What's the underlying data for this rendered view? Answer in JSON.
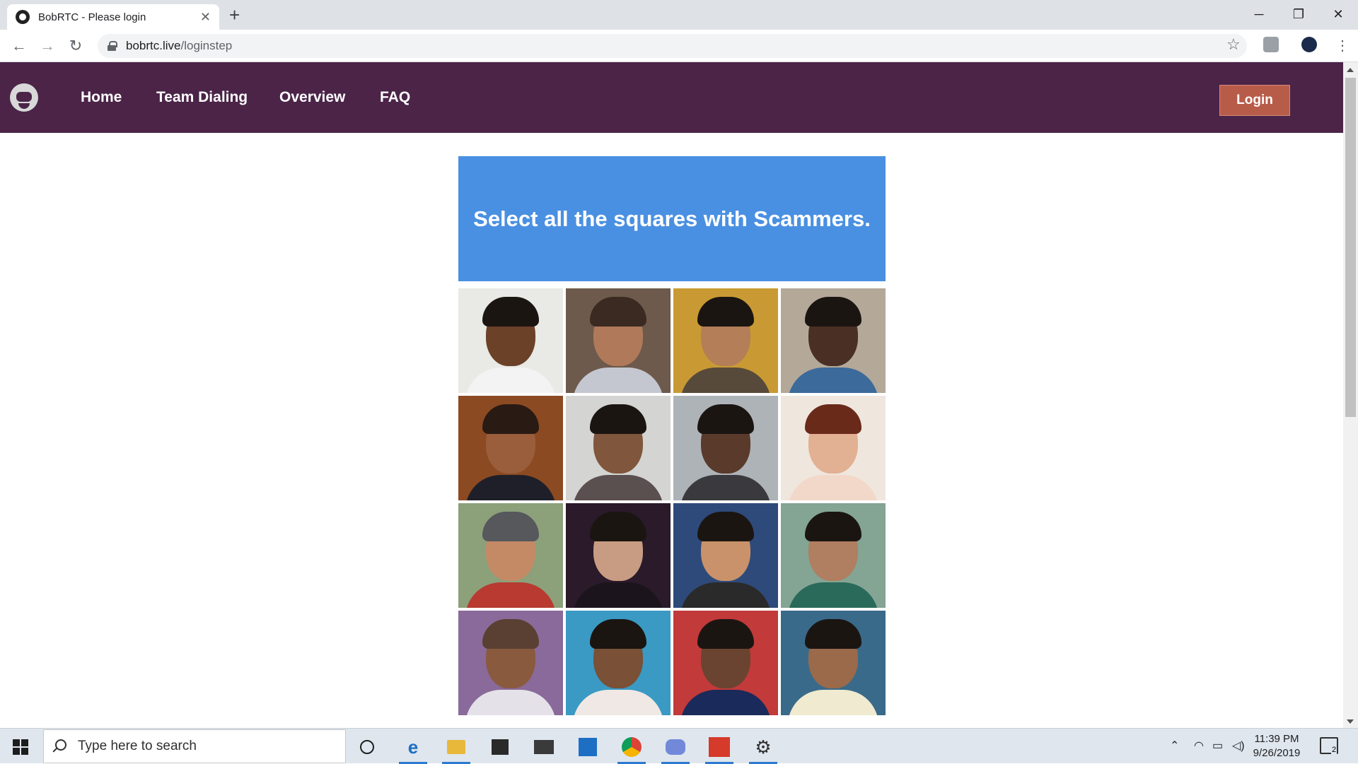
{
  "browser": {
    "tab_title": "BobRTC - Please login",
    "tab_close": "✕",
    "new_tab": "+",
    "url_host": "bobrtc.live",
    "url_path": "/loginstep",
    "win_min": "─",
    "win_restore": "❐",
    "win_close": "✕"
  },
  "site": {
    "nav_links": [
      "Home",
      "Team Dialing",
      "Overview",
      "FAQ"
    ],
    "login_label": "Login",
    "brand_color": "#4b2448",
    "login_color": "#b85c4a"
  },
  "captcha": {
    "instruction": "Select all the squares with Scammers.",
    "header_color": "#4a90e2",
    "tile_count": 16
  },
  "taskbar": {
    "search_placeholder": "Type here to search",
    "time": "11:39 PM",
    "date": "9/26/2019",
    "notification_count": "2",
    "pinned_apps": [
      "cortana-icon",
      "edge-icon",
      "file-explorer-icon",
      "store-icon",
      "mail-icon",
      "azure-icon",
      "chrome-icon",
      "discord-icon",
      "voicemeeter-icon",
      "settings-icon"
    ]
  }
}
